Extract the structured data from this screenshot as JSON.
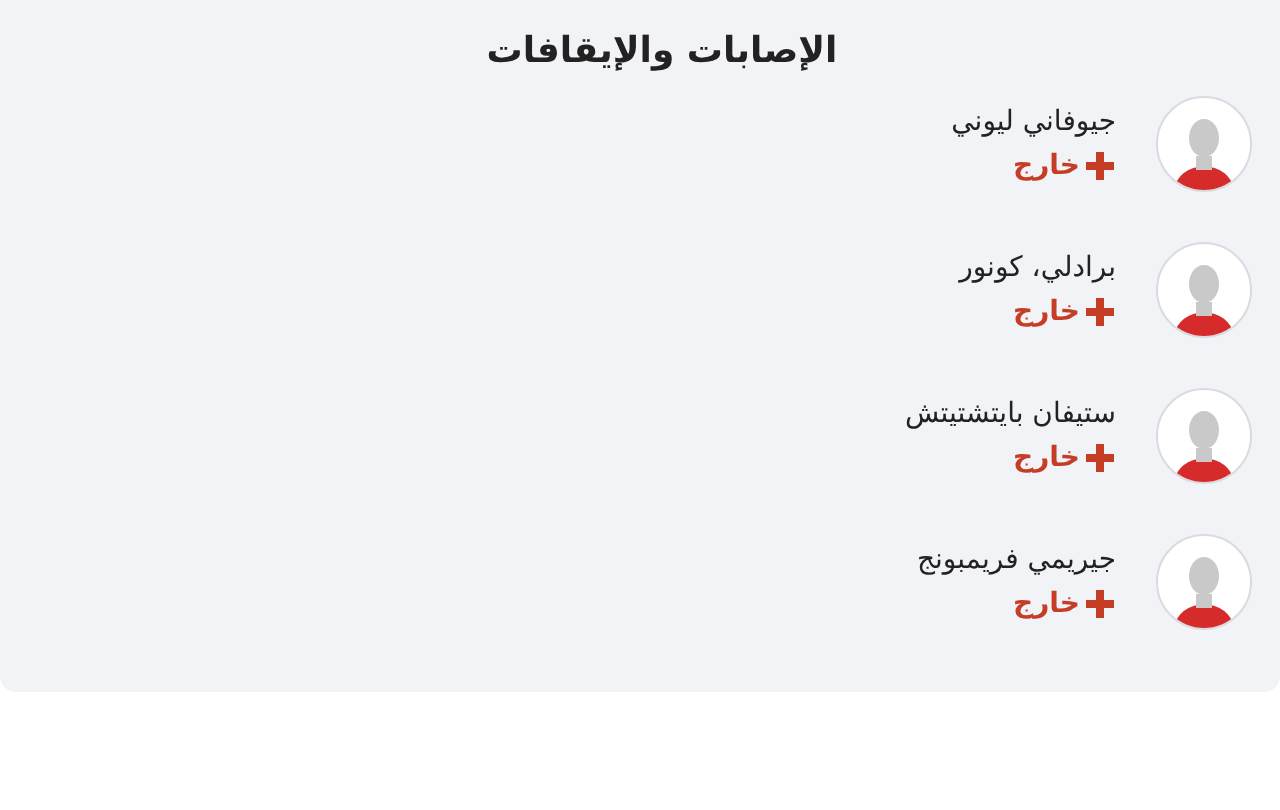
{
  "panel": {
    "title": "الإصابات والإيقافات"
  },
  "players": [
    {
      "name": "جيوفاني ليوني",
      "status": "خارج"
    },
    {
      "name": "برادلي، كونور",
      "status": "خارج"
    },
    {
      "name": "ستيفان بايتشتيتش",
      "status": "خارج"
    },
    {
      "name": "جيريمي فريمبونج",
      "status": "خارج"
    }
  ]
}
